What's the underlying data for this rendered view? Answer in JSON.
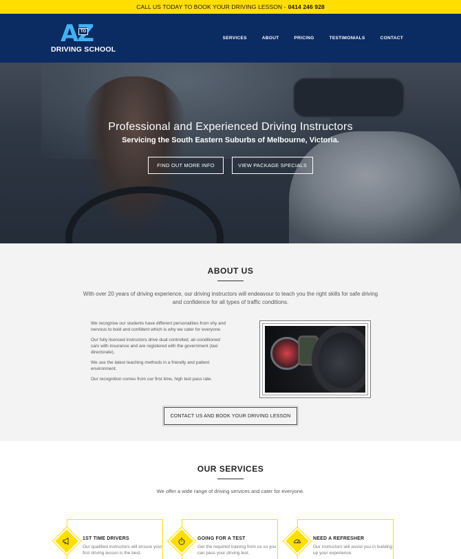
{
  "topbar": {
    "text": "CALL US TODAY TO BOOK YOUR DRIVING LESSON - ",
    "phone": "0414 246 928"
  },
  "logo": {
    "main": "AZ",
    "to": "TO",
    "sub": "DRIVING SCHOOL"
  },
  "nav": {
    "items": [
      "SERVICES",
      "ABOUT",
      "PRICING",
      "TESTIMONIALS",
      "CONTACT"
    ]
  },
  "hero": {
    "title": "Professional and Experienced Driving Instructors",
    "subtitle": "Servicing the South Eastern Suburbs of Melbourne, Victoria.",
    "button_info": "FIND OUT MORE INFO",
    "button_specials": "VIEW PACKAGE SPECIALS"
  },
  "about": {
    "heading": "ABOUT US",
    "lead": "With over 20 years of driving experience, our driving instructors will endeavour to teach you the right skills for safe driving and confidence for all types of traffic conditions.",
    "paragraphs": [
      "We recognise our students have different personalities from shy and nervous to bold and confident which is why we cater for everyone.",
      "Our fully licensed instructors drive dual controlled, air-conditioned cars with insurance and are registered with the government (taxi directorate).",
      "We use the latest teaching methods in a friendly and patient environment.",
      "Our recognition comes from our first time, high test pass rate."
    ],
    "cta": "CONTACT US AND BOOK YOUR DRIVING LESSON"
  },
  "services": {
    "heading": "OUR SERVICES",
    "lead": "We offer a wide range of driving services and cater for everyone.",
    "cards": [
      {
        "title": "1ST TIME DRIVERS",
        "desc": "Our qualified instructors will ensure your first driving lesson is the best.",
        "icon": "megaphone-icon"
      },
      {
        "title": "GOING FOR A TEST",
        "desc": "Get the required training from us so you can pass your driving test.",
        "icon": "stopwatch-icon"
      },
      {
        "title": "NEED A REFRESHER",
        "desc": "Our instructors will assist you in building up your experience.",
        "icon": "speedometer-icon"
      }
    ]
  },
  "colors": {
    "yellow": "#ffde00",
    "navy": "#0b2b63",
    "logo_blue": "#44b0f0"
  }
}
